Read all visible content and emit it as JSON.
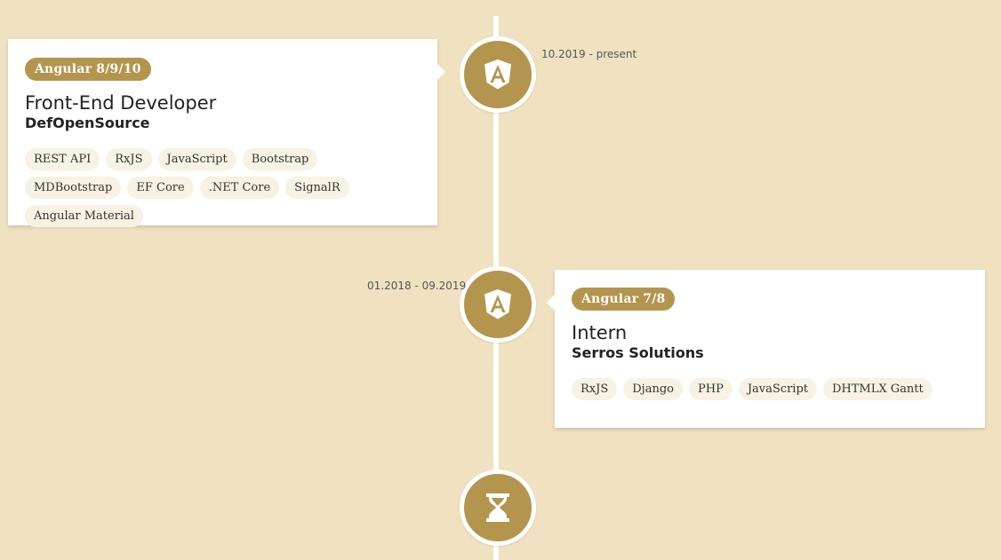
{
  "timeline": {
    "entries": [
      {
        "badge": "Angular 8/9/10",
        "role": "Front-End Developer",
        "company": "DefOpenSource",
        "date": "10.2019 - present",
        "icon": "angular-icon",
        "tags": [
          "REST API",
          "RxJS",
          "JavaScript",
          "Bootstrap",
          "MDBootstrap",
          "EF Core",
          ".NET Core",
          "SignalR",
          "Angular Material"
        ]
      },
      {
        "badge": "Angular 7/8",
        "role": "Intern",
        "company": "Serros Solutions",
        "date": "01.2018 - 09.2019",
        "icon": "angular-icon",
        "tags": [
          "RxJS",
          "Django",
          "PHP",
          "JavaScript",
          "DHTMLX Gantt"
        ]
      }
    ],
    "end_icon": "hourglass-icon"
  },
  "colors": {
    "background": "#f0e2c0",
    "accent": "#b3954e",
    "card": "#ffffff",
    "tag_bg": "#f7f2e3"
  }
}
